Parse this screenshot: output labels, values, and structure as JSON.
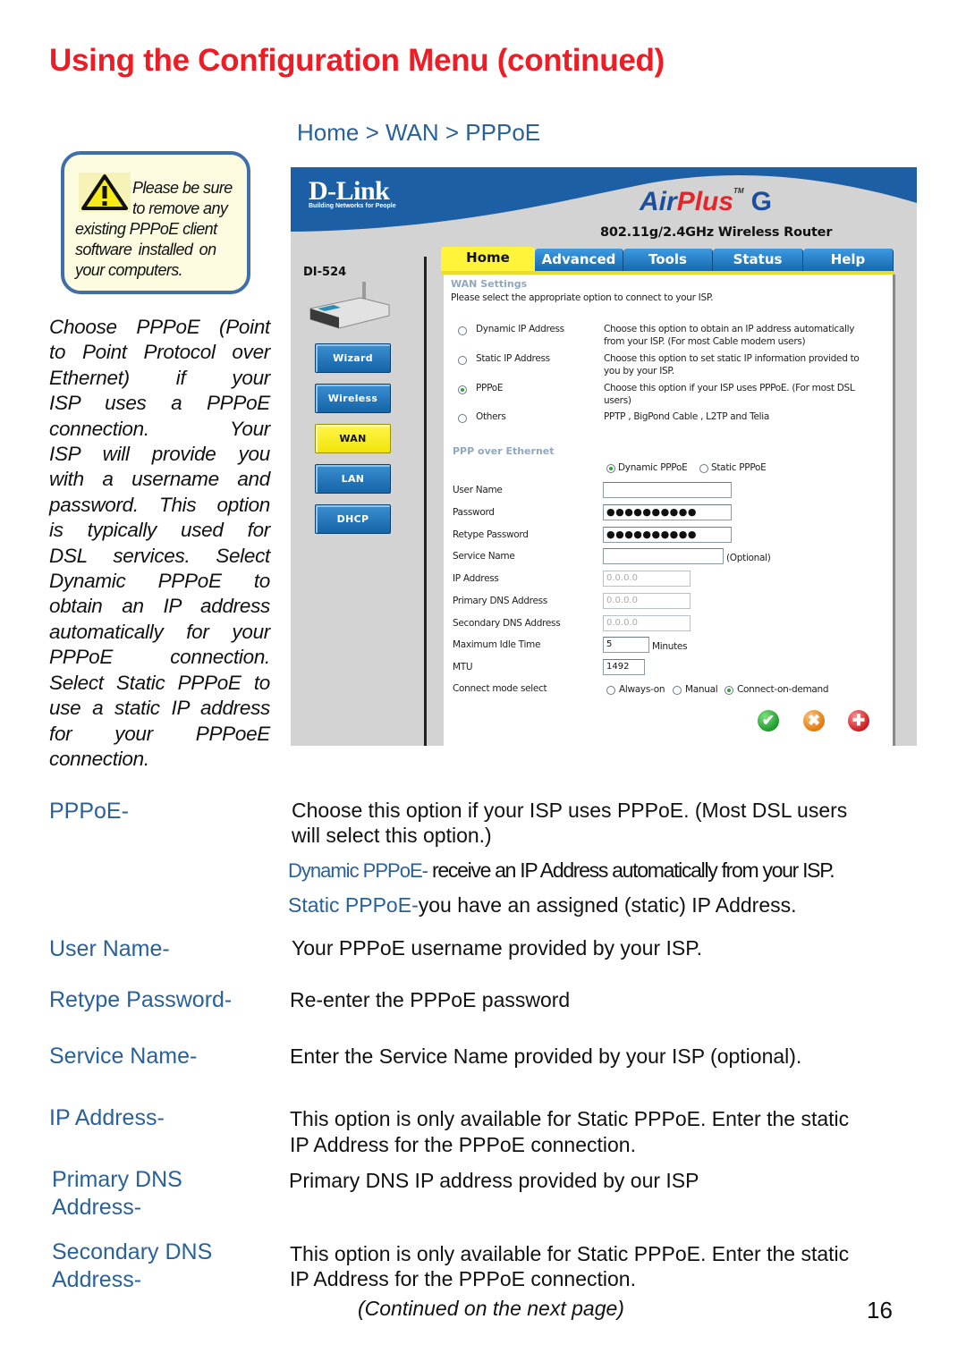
{
  "page": {
    "title": "Using the Configuration Menu (continued)",
    "breadcrumb": "Home > WAN > PPPoE",
    "page_number": "16",
    "continued_note": "(Continued on the next page)",
    "colors": {
      "title": "#ee1c25",
      "term": "#2a6199",
      "note_border": "#3f6ea8",
      "note_bg": "#fefce0"
    }
  },
  "note": {
    "icon": "warning-icon",
    "lines": [
      "Please be sure",
      "to remove any",
      "existing PPPoE client",
      "software installed on",
      "your computers."
    ]
  },
  "side_text": {
    "lines": [
      "Choose PPPoE (Point",
      "to Point Protocol over",
      "Ethernet) if your",
      "ISP uses a PPPoE",
      "connection. Your",
      "ISP will provide you",
      "with a username and",
      "password. This option",
      "is typically used for",
      "DSL services. Select",
      "Dynamic PPPoE to",
      "obtain an IP address",
      "automatically for your",
      "PPPoE connection.",
      "Select Static PPPoE to",
      "use a static IP address",
      "for your PPPoeE",
      "connection."
    ]
  },
  "router_ui": {
    "brand": "D-Link",
    "brand_tagline": "Building Networks for People",
    "product_a": "Air",
    "product_b": "Plus",
    "product_tm": "TM",
    "product_g": "G",
    "product_subtitle": "802.11g/2.4GHz Wireless Router",
    "model": "DI-524",
    "tabs": [
      {
        "label": "Home",
        "active": true
      },
      {
        "label": "Advanced",
        "active": false
      },
      {
        "label": "Tools",
        "active": false
      },
      {
        "label": "Status",
        "active": false
      },
      {
        "label": "Help",
        "active": false
      }
    ],
    "side_buttons": [
      {
        "label": "Wizard",
        "active": false
      },
      {
        "label": "Wireless",
        "active": false
      },
      {
        "label": "WAN",
        "active": true
      },
      {
        "label": "LAN",
        "active": false
      },
      {
        "label": "DHCP",
        "active": false
      }
    ],
    "wan_settings": {
      "title": "WAN Settings",
      "instruction": "Please select the appropriate option to connect to your ISP.",
      "options": [
        {
          "label": "Dynamic IP Address",
          "desc1": "Choose this option to obtain an IP address automatically",
          "desc2": "from your ISP. (For most Cable modem users)",
          "checked": false
        },
        {
          "label": "Static IP Address",
          "desc1": "Choose this option to set static IP information provided to",
          "desc2": "you by your ISP.",
          "checked": false
        },
        {
          "label": "PPPoE",
          "desc1": "Choose this option if your ISP uses PPPoE. (For most DSL",
          "desc2": "users)",
          "checked": true
        },
        {
          "label": "Others",
          "desc1": "PPTP , BigPond Cable , L2TP and Telia",
          "desc2": "",
          "checked": false
        }
      ]
    },
    "pppoe": {
      "title": "PPP over Ethernet",
      "mode_options": [
        {
          "label": "Dynamic PPPoE",
          "checked": true
        },
        {
          "label": "Static PPPoE",
          "checked": false
        }
      ],
      "fields": {
        "user_name": {
          "label": "User Name",
          "value": ""
        },
        "password": {
          "label": "Password",
          "value": "●●●●●●●●●●"
        },
        "retype_password": {
          "label": "Retype Password",
          "value": "●●●●●●●●●●"
        },
        "service_name": {
          "label": "Service Name",
          "value": "",
          "suffix": "(Optional)"
        },
        "ip_address": {
          "label": "IP Address",
          "value": "0.0.0.0"
        },
        "primary_dns": {
          "label": "Primary DNS Address",
          "value": "0.0.0.0"
        },
        "secondary_dns": {
          "label": "Secondary DNS Address",
          "value": "0.0.0.0"
        },
        "max_idle_time": {
          "label": "Maximum Idle Time",
          "value": "5",
          "suffix": "Minutes"
        },
        "mtu": {
          "label": "MTU",
          "value": "1492"
        }
      },
      "connect_mode": {
        "label": "Connect mode select",
        "options": [
          {
            "label": "Always-on",
            "checked": false
          },
          {
            "label": "Manual",
            "checked": false
          },
          {
            "label": "Connect-on-demand",
            "checked": true
          }
        ]
      }
    },
    "actions": {
      "apply_icon": "check-icon",
      "cancel_icon": "x-icon",
      "help_icon": "plus-icon",
      "apply_glyph": "✔",
      "cancel_glyph": "✖",
      "help_glyph": "✚"
    }
  },
  "definitions": [
    {
      "term": "PPPoE-",
      "desc": [
        "Choose this option if your ISP uses PPPoE. (Most DSL users",
        "will select this option.)"
      ]
    },
    {
      "term": "User Name-",
      "desc": [
        "Your PPPoE username provided by your ISP."
      ]
    },
    {
      "term": "Retype Password-",
      "desc": [
        "Re-enter the PPPoE password"
      ]
    },
    {
      "term": "Service Name-",
      "desc": [
        "Enter the Service Name provided by your ISP (optional)."
      ]
    },
    {
      "term": "IP Address-",
      "desc": [
        "This option is only available for Static PPPoE. Enter the static",
        "IP Address for the PPPoE connection."
      ]
    },
    {
      "term": "Primary DNS",
      "term2": "Address-",
      "desc": [
        "Primary DNS IP address provided by our ISP"
      ]
    },
    {
      "term": "Secondary DNS",
      "term2": "Address-",
      "desc": [
        "This option is only available for Static PPPoE. Enter the static",
        "IP Address for the PPPoE connection."
      ]
    }
  ],
  "sub_definitions": [
    {
      "term": "Dynamic PPPoE-",
      "desc": " receive an IP Address automatically from your ISP."
    },
    {
      "term": "Static PPPoE-",
      "desc": "you have an assigned (static) IP Address."
    }
  ]
}
